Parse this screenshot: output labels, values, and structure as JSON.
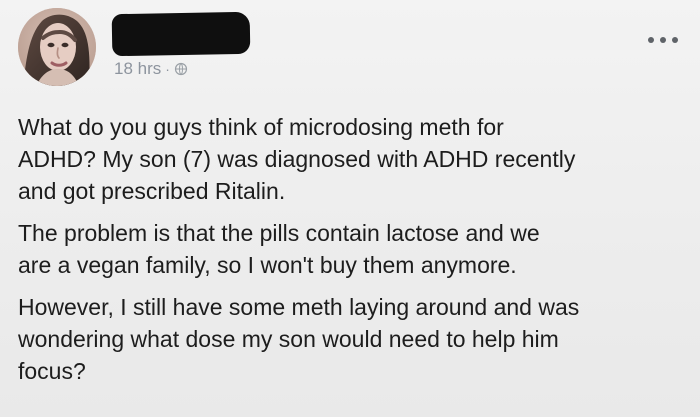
{
  "post": {
    "author_name_redacted": true,
    "timestamp": "18 hrs",
    "meta_separator": "·",
    "audience_icon": "globe-icon",
    "more_icon": "more-options-icon",
    "paragraphs": [
      "What do you guys think of microdosing meth for\nADHD? My son (7) was diagnosed with ADHD recently\nand got prescribed Ritalin.",
      "The problem is that the pills contain lactose and we\nare a vegan family, so I won't buy them anymore.",
      "However, I still have some meth laying around and was\nwondering what dose my son would need to help him\nfocus?"
    ]
  },
  "colors": {
    "background": "#efefef",
    "text_primary": "#1d1d1d",
    "text_secondary": "#8d949e",
    "redaction": "#0f0f0f"
  }
}
